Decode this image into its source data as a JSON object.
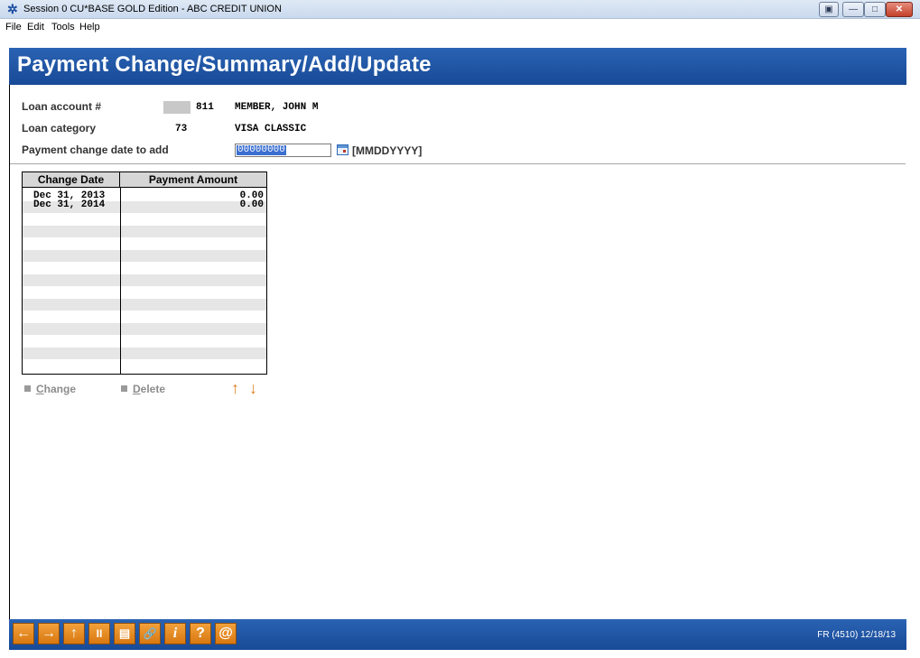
{
  "window": {
    "title": "Session 0 CU*BASE GOLD Edition - ABC CREDIT UNION",
    "icon": "cu-star-icon",
    "special_button": "▣",
    "minimize": "—",
    "maximize": "□",
    "close": "✕"
  },
  "menu": [
    "File",
    "Edit",
    "Tools",
    "Help"
  ],
  "header": {
    "title": "Payment Change/Summary/Add/Update"
  },
  "form": {
    "loan_account_label": "Loan account #",
    "loan_account_suffix": "811",
    "member_name": "MEMBER, JOHN M",
    "loan_category_label": "Loan category",
    "loan_category_code": "73",
    "loan_category_desc": "VISA CLASSIC",
    "change_date_label": "Payment change date to add",
    "change_date_value": "00000000",
    "date_format": "[MMDDYYYY]"
  },
  "grid": {
    "columns": [
      "Change Date",
      "Payment Amount"
    ],
    "rows": [
      {
        "date": "Dec 31, 2013",
        "amount": "0.00"
      },
      {
        "date": "Dec 31, 2014",
        "amount": "0.00"
      }
    ]
  },
  "actions": {
    "change_first": "C",
    "change_rest": "hange",
    "delete_first": "D",
    "delete_rest": "elete",
    "up_arrow": "↑",
    "down_arrow": "↓"
  },
  "footer": {
    "buttons": [
      "←",
      "→",
      "↑",
      "II",
      "▤",
      "🔗",
      "i",
      "?",
      "@"
    ],
    "code": "FR (4510) 12/18/13"
  },
  "colors": {
    "header_blue": "#1f56a5",
    "button_orange": "#e58a22",
    "selection_blue": "#3b6fd1"
  }
}
